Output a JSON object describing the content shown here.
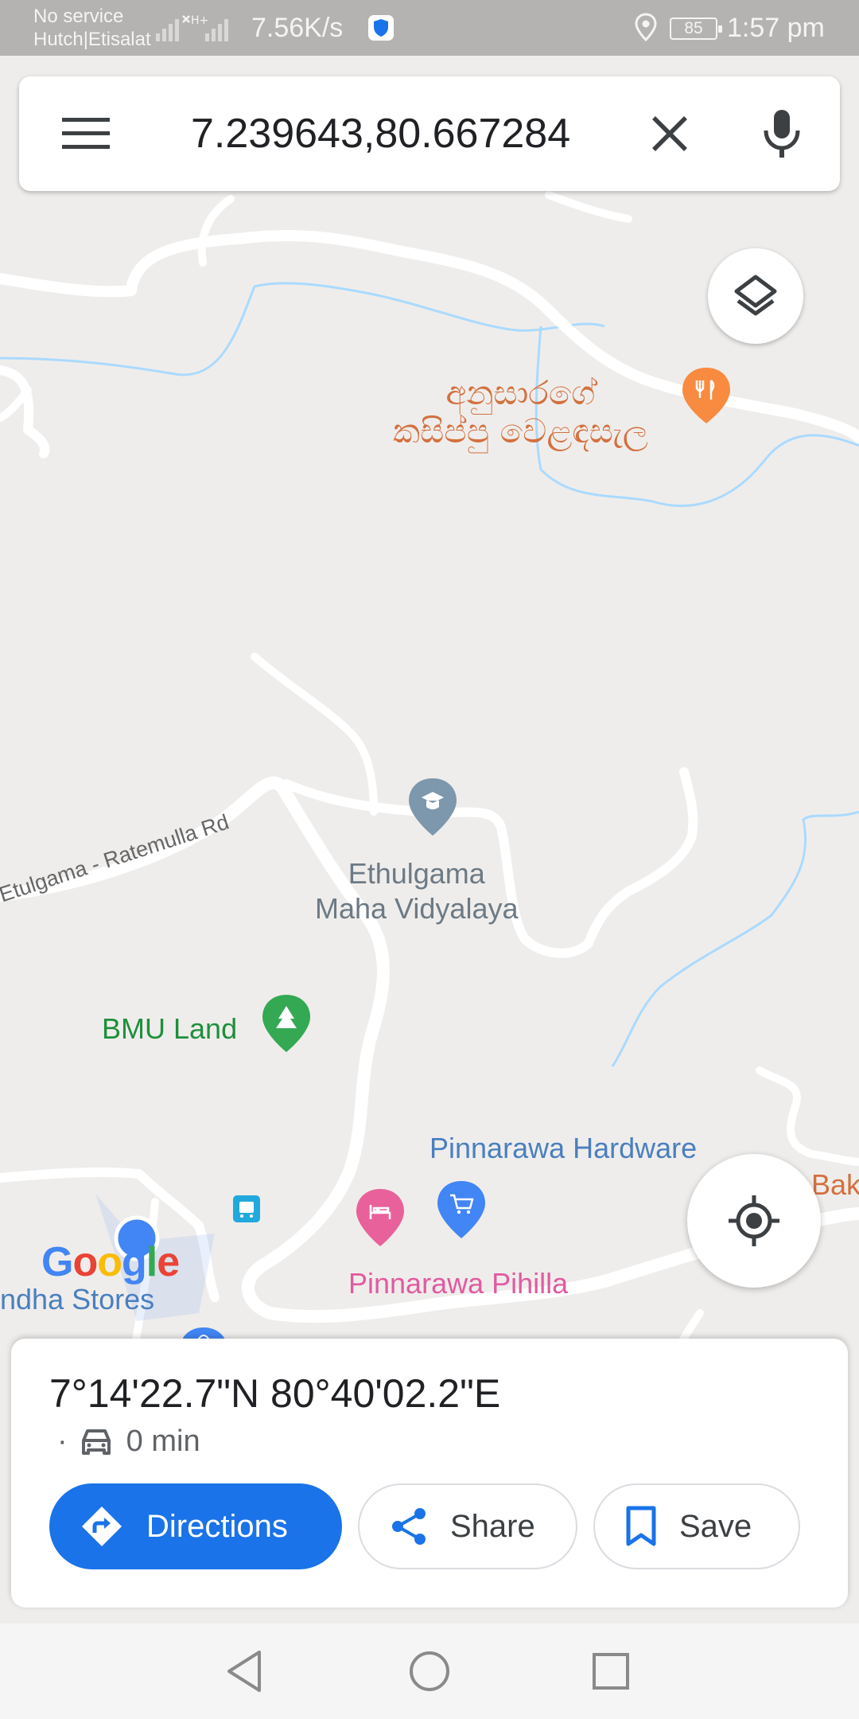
{
  "status_bar": {
    "carrier_line1": "No service",
    "carrier_line2": "Hutch|Etisalat",
    "speed": "7.56K/s",
    "battery": "85",
    "time": "1:57 pm"
  },
  "search": {
    "query": "7.239643,80.667284",
    "menu_icon": "hamburger-menu-icon",
    "close_icon": "close-icon",
    "mic_icon": "microphone-icon"
  },
  "map": {
    "labels": {
      "restaurant_line1": "අනුසාරගේ",
      "restaurant_line2": "කසිප්පු වෙළඳසැල",
      "road": "Etulgama - Ratemulla Rd",
      "school_line1": "Ethulgama",
      "school_line2": "Maha Vidyalaya",
      "bmu_land": "BMU Land",
      "hardware": "Pinnarawa Hardware",
      "bak": "Bak",
      "pihilla": "Pinnarawa Pihilla",
      "stores": "ndha Stores"
    },
    "logo": {
      "g1": "G",
      "o1": "o",
      "o2": "o",
      "g2": "g",
      "l": "l",
      "e": "e"
    },
    "colors": {
      "background": "#efedeb",
      "road": "#ffffff",
      "water": "#aadaff",
      "restaurant_pin": "#f88b3f",
      "school_pin": "#7d97ad",
      "park_pin": "#34a853",
      "shopping_pin": "#4285f4",
      "lodging_pin": "#e8619a",
      "my_location_dot": "#4285f4"
    }
  },
  "place_sheet": {
    "coordinates": "7°14'22.7\"N 80°40'02.2\"E",
    "dot": "·",
    "drive_time": "0 min",
    "directions_label": "Directions",
    "share_label": "Share",
    "save_label": "Save"
  }
}
